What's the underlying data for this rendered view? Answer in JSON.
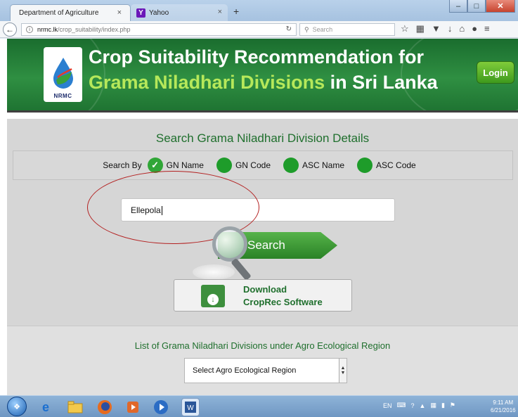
{
  "browser": {
    "tabs": [
      {
        "label": "Department of Agriculture",
        "close": "×"
      },
      {
        "label": "Yahoo",
        "close": "×",
        "icon": "Y"
      }
    ],
    "new_tab": "+",
    "url_host": "nrmc.lk",
    "url_path": "/crop_suitability/index.php",
    "search_placeholder": "Search"
  },
  "header": {
    "title_line1": "Crop Suitability Recommendation for",
    "title_highlight": "Grama Niladhari Divisions",
    "title_rest": " in Sri Lanka",
    "logo_text": "NRMC",
    "login_label": "Login",
    "brand_green": "#2f8f42",
    "highlight_color": "#b6e85a"
  },
  "search": {
    "heading": "Search Grama Niladhari Division Details",
    "search_by_label": "Search By",
    "options": [
      {
        "label": "GN Name",
        "checked": true
      },
      {
        "label": "GN Code",
        "checked": false
      },
      {
        "label": "ASC Name",
        "checked": false
      },
      {
        "label": "ASC Code",
        "checked": false
      }
    ],
    "input_value": "Ellepola",
    "button_label": "Search"
  },
  "download": {
    "line1": "Download",
    "line2": "CropRec Software"
  },
  "agro": {
    "title": "List of Grama Niladhari Divisions under Agro Ecological Region",
    "select_value": "Select Agro Ecological Region"
  },
  "taskbar": {
    "lang": "EN",
    "time": "9:11 AM",
    "date": "6/21/2016"
  }
}
